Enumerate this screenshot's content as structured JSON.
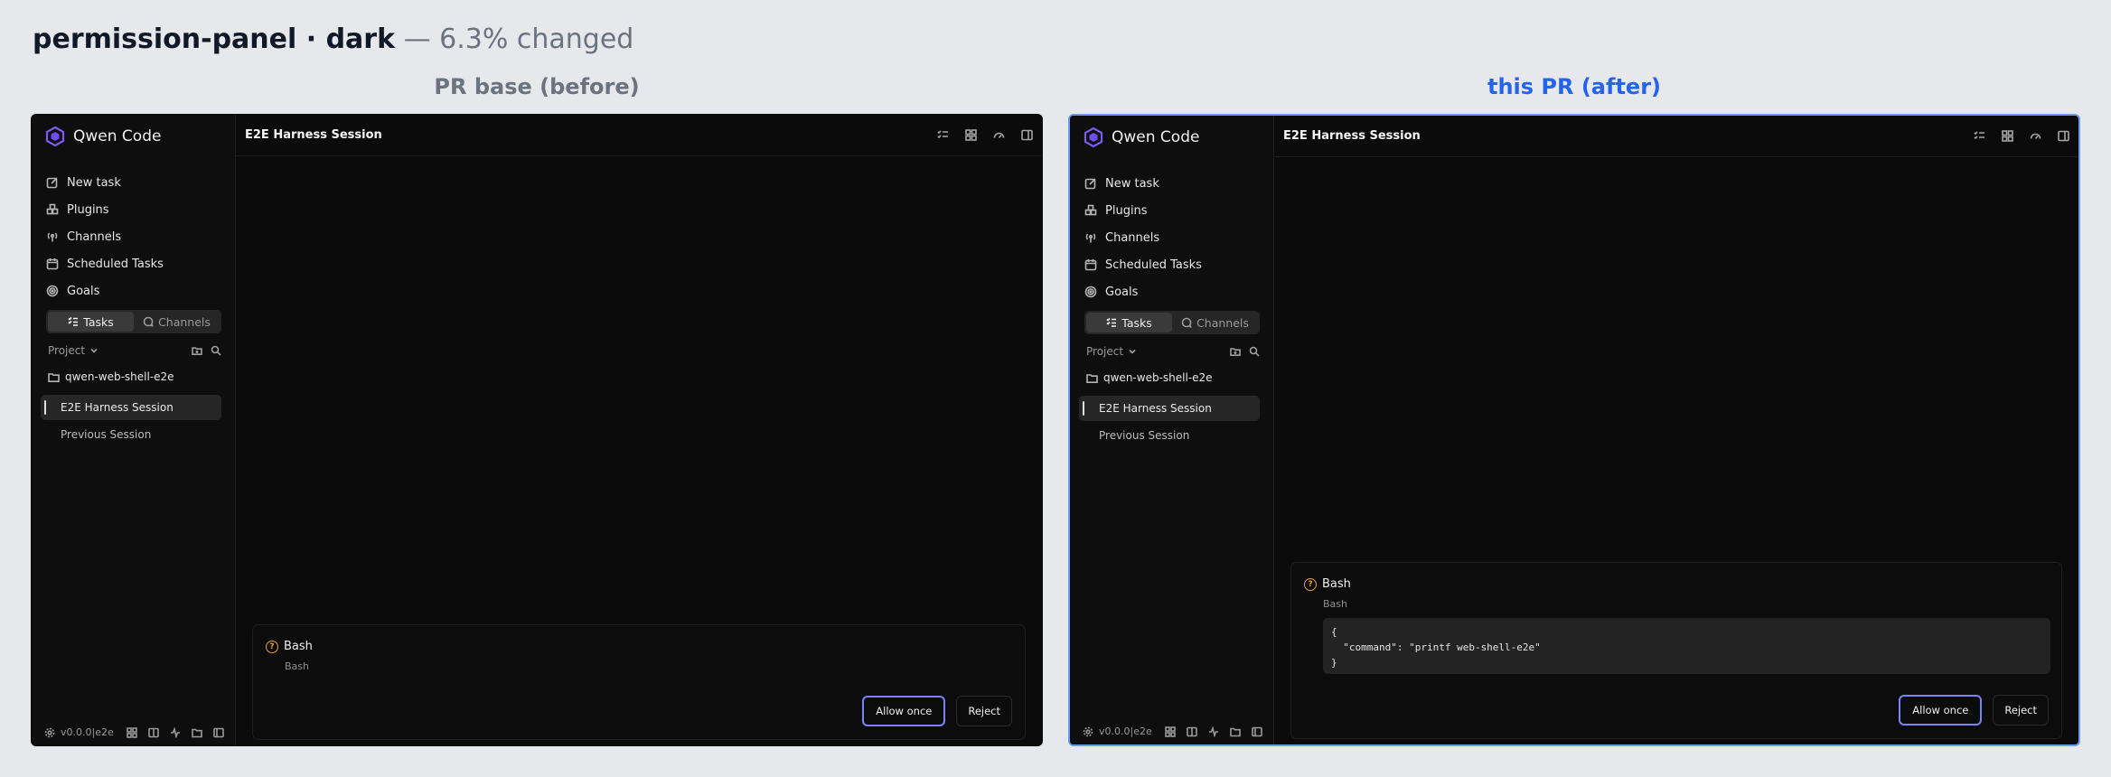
{
  "page": {
    "title": "permission-panel · dark",
    "suffix": "— 6.3% changed"
  },
  "columns": {
    "before": "PR base (before)",
    "after": "this PR (after)"
  },
  "app": {
    "brand": "Qwen Code",
    "nav": [
      "New task",
      "Plugins",
      "Channels",
      "Scheduled Tasks",
      "Goals"
    ],
    "segment": {
      "tasks": "Tasks",
      "channels": "Channels"
    },
    "project_label": "Project",
    "folder": "qwen-web-shell-e2e",
    "sessions": {
      "active": "E2E Harness Session",
      "previous": "Previous Session"
    },
    "version": "v0.0.0|e2e",
    "header_title": "E2E Harness Session"
  },
  "permission": {
    "tool": "Bash",
    "subtitle": "Bash",
    "code": "{\n  \"command\": \"printf web-shell-e2e\"\n}",
    "allow_label": "Allow once",
    "reject_label": "Reject"
  }
}
